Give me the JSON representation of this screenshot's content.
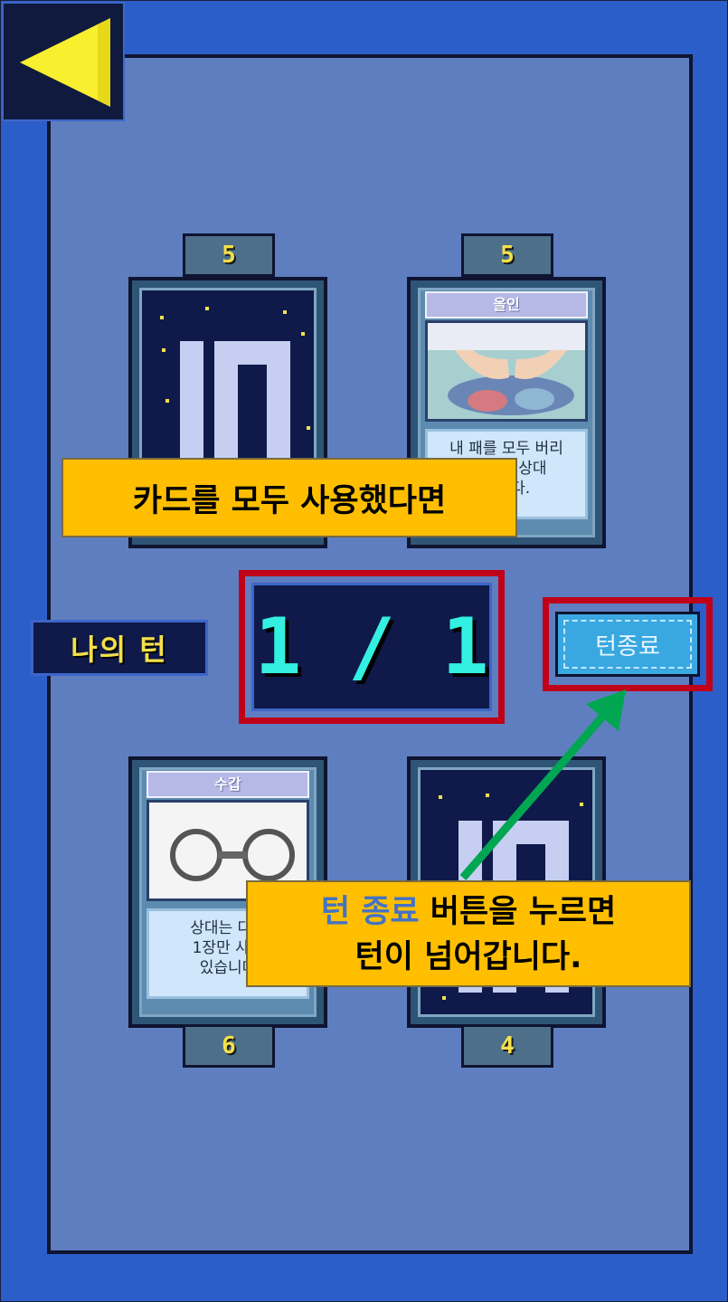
{
  "cards": {
    "top_left": {
      "count": "5"
    },
    "top_right": {
      "count": "5",
      "title": "올인",
      "desc_lines": [
        "내 패를 모두 버리",
        "고 게임 상대",
        "합니다."
      ]
    },
    "bottom_left": {
      "count": "6",
      "title": "수갑",
      "desc_lines": [
        "상대는 다음",
        "1장만 사용",
        "있습니다"
      ]
    },
    "bottom_right": {
      "count": "4"
    }
  },
  "turn": {
    "label": "나의 턴",
    "counter": "1 / 1",
    "end_button": "턴종료"
  },
  "tutorial": {
    "hint_top": "카드를 모두 사용했다면",
    "hint_bottom_highlight": "턴 종료",
    "hint_bottom_rest": " 버튼을 누르면",
    "hint_bottom_line2": "턴이 넘어갑니다."
  },
  "colors": {
    "highlight": "#c00018",
    "callout": "#ffbf00",
    "arrow": "#00a651",
    "counter_text": "#34f0e0",
    "accent_text": "#f3e04a"
  }
}
